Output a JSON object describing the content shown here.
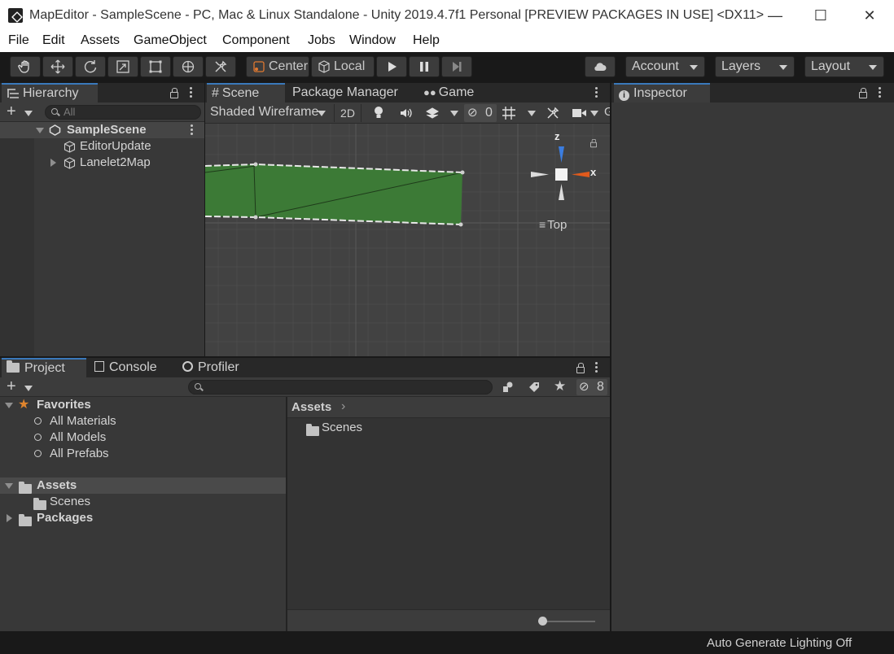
{
  "window": {
    "title": "MapEditor - SampleScene - PC, Mac & Linux Standalone - Unity 2019.4.7f1 Personal [PREVIEW PACKAGES IN USE] <DX11>",
    "minimize": "—",
    "maximize": "☐",
    "close": "✕"
  },
  "menu": [
    "File",
    "Edit",
    "Assets",
    "GameObject",
    "Component",
    "Jobs",
    "Window",
    "Help"
  ],
  "toolbar": {
    "pivot_center": "Center",
    "pivot_local": "Local",
    "account": "Account",
    "layers": "Layers",
    "layout": "Layout"
  },
  "hierarchy": {
    "tab": "Hierarchy",
    "search_placeholder": "All",
    "scene": "SampleScene",
    "items": [
      "EditorUpdate",
      "Lanelet2Map"
    ]
  },
  "scene_panel": {
    "tabs": [
      "Scene",
      "Package Manager",
      "Game"
    ],
    "shading_mode": "Shaded Wireframe",
    "mode_2d": "2D",
    "hidden_count": "0",
    "gizmo": {
      "z": "z",
      "x": "x",
      "view": "Top"
    }
  },
  "inspector": {
    "tab": "Inspector"
  },
  "project": {
    "tabs": [
      "Project",
      "Console",
      "Profiler"
    ],
    "hidden_count": "8",
    "favorites": {
      "label": "Favorites",
      "items": [
        "All Materials",
        "All Models",
        "All Prefabs"
      ]
    },
    "assets": {
      "label": "Assets",
      "children": [
        "Scenes"
      ]
    },
    "packages": "Packages",
    "breadcrumb": "Assets",
    "folder_contents": [
      "Scenes"
    ]
  },
  "statusbar": {
    "text": "Auto Generate Lighting Off"
  },
  "colors": {
    "accent_blue": "#3a79bb",
    "road_green": "#3a7a3a",
    "axis_x": "#e05a1c",
    "axis_z": "#3b7de0",
    "favorite_star": "#e0852d"
  },
  "icons": [
    "hand-icon",
    "move-icon",
    "rotate-icon",
    "scale-icon",
    "rect-icon",
    "transform-icon",
    "custom-tool-icon",
    "play-icon",
    "pause-icon",
    "step-icon",
    "cloud-icon"
  ]
}
